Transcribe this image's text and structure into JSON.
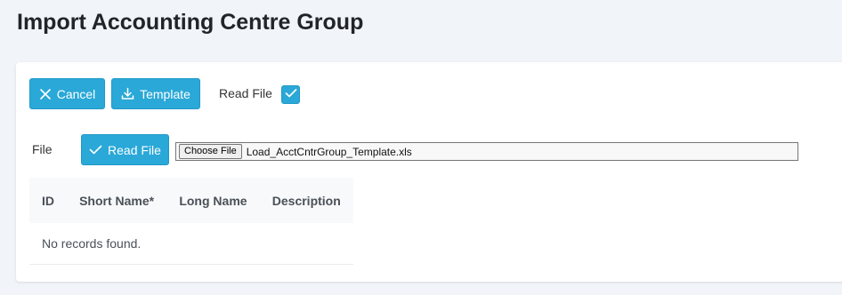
{
  "page": {
    "title": "Import Accounting Centre Group"
  },
  "toolbar": {
    "cancel_label": "Cancel",
    "template_label": "Template",
    "read_file_checkbox_label": "Read File",
    "read_file_checked": true
  },
  "file_row": {
    "label": "File",
    "read_file_button_label": "Read File",
    "choose_file_label": "Choose File",
    "selected_file": "Load_AcctCntrGroup_Template.xls"
  },
  "table": {
    "columns": [
      "ID",
      "Short Name*",
      "Long Name",
      "Description"
    ],
    "empty_message": "No records found."
  },
  "icons": {
    "cancel": "close-icon",
    "template": "download-icon",
    "read_file": "check-icon",
    "checkbox": "check-icon"
  },
  "colors": {
    "primary": "#2aa8d8",
    "background": "#f1f4f8",
    "card": "#ffffff"
  }
}
